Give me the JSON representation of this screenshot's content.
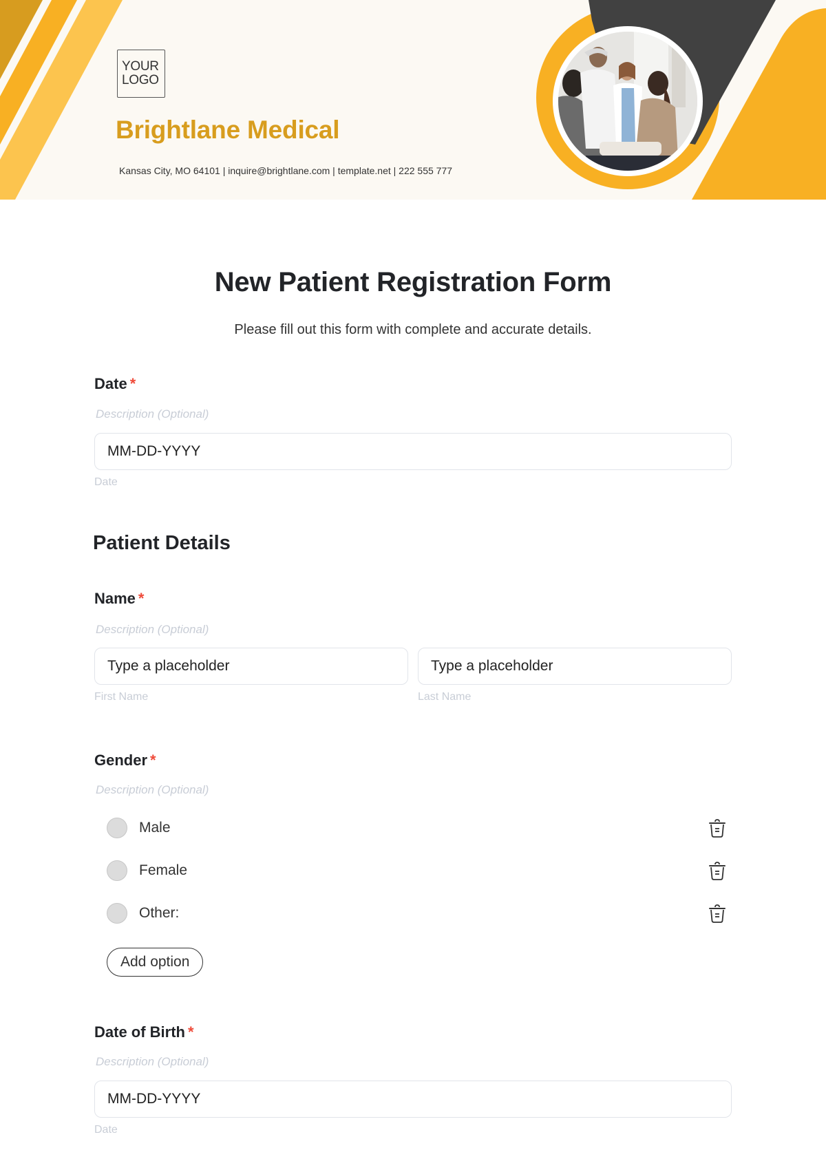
{
  "header": {
    "logo_line1": "YOUR",
    "logo_line2": "LOGO",
    "brand_name": "Brightlane Medical",
    "contact_line": "Kansas City, MO 64101 | inquire@brightlane.com | template.net | 222 555 777",
    "photo_description": "doctors greeting patients in clinic",
    "colors": {
      "background": "#fcf9f3",
      "stripe_dark": "#d79c1f",
      "stripe_mid": "#f8b023",
      "stripe_light": "#fcc44e",
      "accent_orange": "#f8b023",
      "charcoal": "#414141",
      "brand_text": "#d89d1e"
    }
  },
  "form": {
    "title": "New Patient Registration Form",
    "subtitle": "Please fill out this form with complete and accurate details.",
    "required_marker": "*",
    "fields": {
      "date": {
        "label": "Date",
        "description_placeholder": "Description (Optional)",
        "value": "MM-DD-YYYY",
        "hint": "Date"
      },
      "section_patient_details": "Patient Details",
      "name": {
        "label": "Name",
        "description_placeholder": "Description (Optional)",
        "first": {
          "placeholder": "Type a placeholder",
          "hint": "First Name"
        },
        "last": {
          "placeholder": "Type a placeholder",
          "hint": "Last Name"
        }
      },
      "gender": {
        "label": "Gender",
        "description_placeholder": "Description (Optional)",
        "options": [
          {
            "label": "Male",
            "selected": false
          },
          {
            "label": "Female",
            "selected": false
          },
          {
            "label": "Other:",
            "selected": false
          }
        ],
        "add_option_label": "Add option",
        "delete_icon": "trash-icon"
      },
      "date_of_birth": {
        "label": "Date of Birth",
        "description_placeholder": "Description (Optional)",
        "value": "MM-DD-YYYY",
        "hint": "Date"
      }
    }
  }
}
